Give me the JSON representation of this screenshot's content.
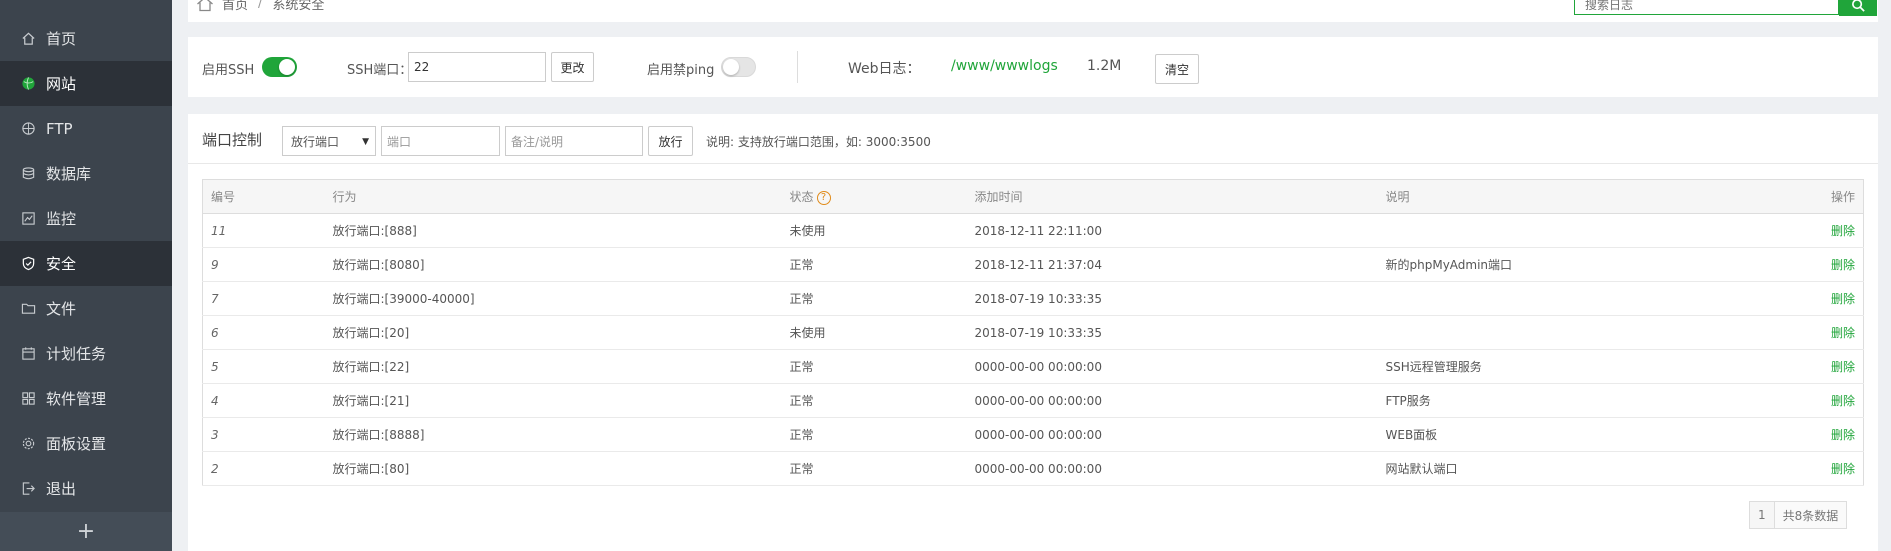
{
  "sidebar": {
    "items": [
      {
        "label": "首页",
        "icon": "home-icon"
      },
      {
        "label": "网站",
        "icon": "globe-icon"
      },
      {
        "label": "FTP",
        "icon": "ftp-icon"
      },
      {
        "label": "数据库",
        "icon": "database-icon"
      },
      {
        "label": "监控",
        "icon": "monitor-icon"
      },
      {
        "label": "安全",
        "icon": "shield-icon"
      },
      {
        "label": "文件",
        "icon": "folder-icon"
      },
      {
        "label": "计划任务",
        "icon": "calendar-icon"
      },
      {
        "label": "软件管理",
        "icon": "apps-icon"
      },
      {
        "label": "面板设置",
        "icon": "gear-icon"
      },
      {
        "label": "退出",
        "icon": "logout-icon"
      }
    ],
    "active_index": 5,
    "hover_index": 1,
    "add_label": "+"
  },
  "breadcrumb": {
    "home": "首页",
    "sep": "/",
    "current": "系统安全"
  },
  "search": {
    "placeholder": "搜索日志"
  },
  "ssh": {
    "ssh_toggle_label": "启用SSH",
    "ssh_enabled": true,
    "port_label": "SSH端口：",
    "port_value": "22",
    "change_button": "更改",
    "ping_label": "启用禁ping",
    "ping_enabled": false,
    "weblog_label": "Web日志：",
    "weblog_path": "/www/wwwlogs",
    "weblog_size": "1.2M",
    "clear_button": "清空"
  },
  "port_control": {
    "title": "端口控制",
    "action_select": "放行端口",
    "port_placeholder": "端口",
    "note_placeholder": "备注/说明",
    "submit_button": "放行",
    "hint": "说明: 支持放行端口范围，如: 3000:3500"
  },
  "table": {
    "headers": {
      "id": "编号",
      "action": "行为",
      "status": "状态",
      "time": "添加时间",
      "note": "说明",
      "op": "操作"
    },
    "status_help": "?",
    "rows": [
      {
        "id": "11",
        "action": "放行端口:[888]",
        "status": "未使用",
        "time": "2018-12-11 22:11:00",
        "note": "",
        "op": "删除"
      },
      {
        "id": "9",
        "action": "放行端口:[8080]",
        "status": "正常",
        "time": "2018-12-11 21:37:04",
        "note": "新的phpMyAdmin端口",
        "op": "删除"
      },
      {
        "id": "7",
        "action": "放行端口:[39000-40000]",
        "status": "正常",
        "time": "2018-07-19 10:33:35",
        "note": "",
        "op": "删除"
      },
      {
        "id": "6",
        "action": "放行端口:[20]",
        "status": "未使用",
        "time": "2018-07-19 10:33:35",
        "note": "",
        "op": "删除"
      },
      {
        "id": "5",
        "action": "放行端口:[22]",
        "status": "正常",
        "time": "0000-00-00 00:00:00",
        "note": "SSH远程管理服务",
        "op": "删除"
      },
      {
        "id": "4",
        "action": "放行端口:[21]",
        "status": "正常",
        "time": "0000-00-00 00:00:00",
        "note": "FTP服务",
        "op": "删除"
      },
      {
        "id": "3",
        "action": "放行端口:[8888]",
        "status": "正常",
        "time": "0000-00-00 00:00:00",
        "note": "WEB面板",
        "op": "删除"
      },
      {
        "id": "2",
        "action": "放行端口:[80]",
        "status": "正常",
        "time": "0000-00-00 00:00:00",
        "note": "网站默认端口",
        "op": "删除"
      }
    ]
  },
  "pager": {
    "current": "1",
    "total": "共8条数据"
  },
  "colors": {
    "accent": "#20a53a",
    "sidebar_bg": "#3c444d",
    "sidebar_active": "#2c3138",
    "warning": "#e08b1b"
  }
}
